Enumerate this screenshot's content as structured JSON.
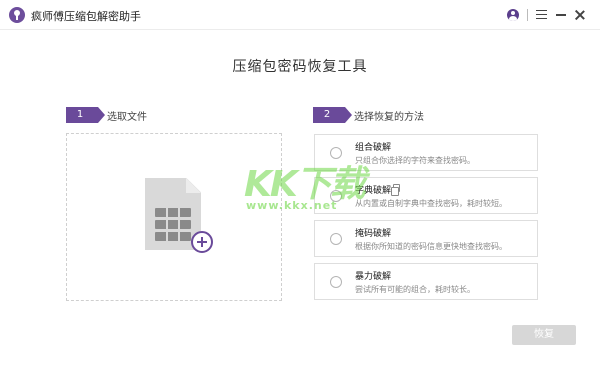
{
  "window": {
    "title": "疯师傅压缩包解密助手",
    "icon": "app-logo-icon"
  },
  "titlebar": {
    "icons": [
      "user-icon",
      "menu-icon",
      "minimize-icon",
      "close-icon"
    ]
  },
  "main": {
    "title": "压缩包密码恢复工具"
  },
  "step1": {
    "number": "1",
    "label": "选取文件"
  },
  "step2": {
    "number": "2",
    "label": "选择恢复的方法"
  },
  "options": [
    {
      "title": "组合破解",
      "desc": "只组合你选择的字符来查找密码。"
    },
    {
      "title": "字典破解",
      "desc": "从内置或自制字典中查找密码，耗时较短。"
    },
    {
      "title": "掩码破解",
      "desc": "根据你所知道的密码信息更快地查找密码。"
    },
    {
      "title": "暴力破解",
      "desc": "尝试所有可能的组合，耗时较长。"
    }
  ],
  "watermark": {
    "main": "KK下载",
    "url": "www.kkx.net"
  },
  "recover_button": {
    "label": "恢复"
  },
  "colors": {
    "accent": "#6a4a9a",
    "button_disabled": "#d7d7d7",
    "watermark": "#6ed746"
  }
}
